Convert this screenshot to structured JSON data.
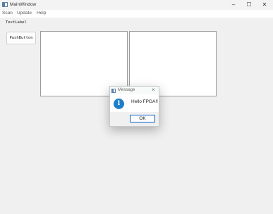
{
  "window": {
    "title": "MainWindow",
    "minimize_icon": "minimize-icon",
    "maximize_icon": "maximize-icon",
    "close_icon": "close-icon"
  },
  "menubar": {
    "items": [
      "Scan",
      "Update",
      "Help"
    ]
  },
  "main": {
    "text_label": "TextLabel",
    "push_button": "PushButton"
  },
  "dialog": {
    "title": "Message",
    "message": "Hello FPGA!!",
    "ok_label": "OK",
    "icon": "information-icon",
    "icon_color": "#1e7fc8"
  }
}
